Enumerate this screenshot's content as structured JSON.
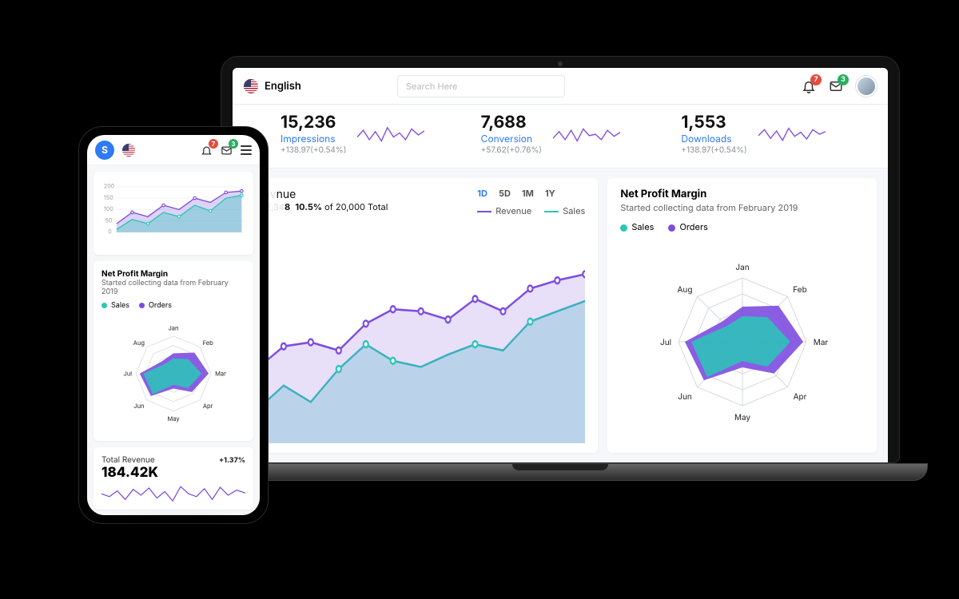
{
  "header": {
    "language_label": "English",
    "search_placeholder": "Search Here",
    "notif_count": "7",
    "msg_count": "3"
  },
  "stats": [
    {
      "value": "15,236",
      "label": "Impressions",
      "delta": "+138.97(+0.54%)"
    },
    {
      "value": "7,688",
      "label": "Conversion",
      "delta": "+57.62(+0.76%)"
    },
    {
      "value": "1,553",
      "label": "Downloads",
      "delta": "+138.97(+0.54%)"
    }
  ],
  "revenue_card": {
    "title_suffix": "nue",
    "amount_suffix": "8",
    "pct": "10.5%",
    "pct_of": " of 20,000 Total",
    "range": [
      "1D",
      "5D",
      "1M",
      "1Y"
    ],
    "range_active": "1D",
    "legend": [
      "Revenue",
      "Sales"
    ]
  },
  "npm_card": {
    "title": "Net Profit Margin",
    "subtitle": "Started collecting data from February 2019",
    "legend": [
      "Sales",
      "Orders"
    ],
    "months": [
      "Jan",
      "Feb",
      "Mar",
      "Apr",
      "May",
      "Jun",
      "Jul",
      "Aug"
    ]
  },
  "phone": {
    "logo": "S",
    "notif_count": "7",
    "msg_count": "3",
    "axis": [
      "0",
      "50",
      "100",
      "150",
      "200"
    ],
    "npm_title": "Net Profit Margin",
    "npm_sub": "Started collecting data from February 2019",
    "legend": [
      "Sales",
      "Orders"
    ],
    "months": [
      "Jan",
      "Feb",
      "Mar",
      "Apr",
      "May",
      "Jun",
      "Jul",
      "Aug"
    ],
    "rev_title": "Total Revenue",
    "rev_value": "184.42K",
    "rev_delta": "+1.37%"
  },
  "colors": {
    "blue": "#2f7bf3",
    "teal": "#29c7b8",
    "purple": "#7d4ce0"
  },
  "chart_data": {
    "sparklines": {
      "type": "line",
      "values": [
        5,
        9,
        4,
        8,
        3,
        10,
        5,
        7,
        4,
        9,
        6,
        8
      ]
    },
    "revenue": {
      "type": "area",
      "x": [
        1,
        2,
        3,
        4,
        5,
        6,
        7,
        8,
        9,
        10,
        11,
        12
      ],
      "series": [
        {
          "name": "Revenue",
          "values": [
            40,
            55,
            58,
            52,
            70,
            80,
            78,
            72,
            86,
            76,
            90,
            95
          ]
        },
        {
          "name": "Sales",
          "values": [
            15,
            30,
            20,
            40,
            55,
            45,
            42,
            50,
            56,
            52,
            68,
            74
          ]
        }
      ],
      "ylim": [
        0,
        100
      ]
    },
    "net_profit_margin": {
      "type": "radar",
      "categories": [
        "Jan",
        "Feb",
        "Mar",
        "Apr",
        "May",
        "Jun",
        "Jul",
        "Aug"
      ],
      "series": [
        {
          "name": "Orders",
          "values": [
            55,
            80,
            95,
            70,
            40,
            85,
            90,
            45
          ]
        },
        {
          "name": "Sales",
          "values": [
            40,
            55,
            75,
            55,
            30,
            78,
            80,
            35
          ]
        }
      ],
      "range": [
        0,
        100
      ]
    },
    "phone_area": {
      "type": "area",
      "y_ticks": [
        0,
        50,
        100,
        150,
        200
      ],
      "x": [
        1,
        2,
        3,
        4,
        5,
        6,
        7,
        8,
        9
      ],
      "series": [
        {
          "name": "Orders",
          "values": [
            40,
            90,
            70,
            120,
            100,
            150,
            130,
            170,
            175
          ]
        },
        {
          "name": "Sales",
          "values": [
            20,
            60,
            40,
            90,
            70,
            120,
            95,
            140,
            150
          ]
        }
      ],
      "ylim": [
        0,
        200
      ]
    },
    "phone_revenue_spark": {
      "type": "line",
      "values": [
        62,
        58,
        65,
        55,
        68,
        60,
        70,
        57,
        66,
        54,
        72,
        63,
        59,
        69,
        55,
        71,
        60,
        68
      ]
    }
  }
}
